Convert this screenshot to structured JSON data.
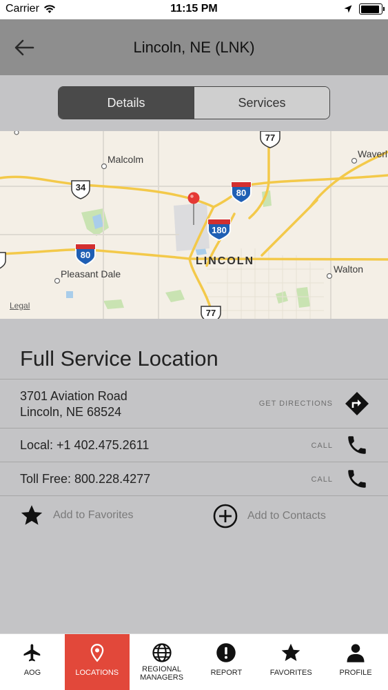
{
  "status_bar": {
    "carrier": "Carrier",
    "time": "11:15 PM",
    "battery_level": 0.9
  },
  "nav": {
    "title": "Lincoln, NE (LNK)",
    "back_icon": "arrow-left-icon"
  },
  "segments": {
    "items": [
      {
        "label": "Details",
        "active": true
      },
      {
        "label": "Services",
        "active": false
      }
    ]
  },
  "map": {
    "labels": {
      "malcolm": "Malcolm",
      "waverly": "Waverl",
      "pleasant_dale": "Pleasant Dale",
      "walton": "Walton",
      "city": "LINCOLN",
      "legal": "Legal"
    },
    "shields": {
      "us34": "34",
      "us77_top": "77",
      "us77_bottom": "77",
      "i80_west": "80",
      "i80_east": "80",
      "i180": "180"
    },
    "pin_color": "#e53935"
  },
  "location": {
    "title": "Full Service Location",
    "address_line1": "3701 Aviation Road",
    "address_line2": "Lincoln, NE  68524",
    "directions_label": "GET DIRECTIONS",
    "local_phone": "Local: +1 402.475.2611",
    "toll_free": "Toll Free: 800.228.4277",
    "call_label": "CALL",
    "add_favorites": "Add to Favorites",
    "add_contacts": "Add to Contacts"
  },
  "tab_bar": {
    "accent_color": "#e2483a",
    "tabs": [
      {
        "label": "AOG",
        "icon": "airplane-icon"
      },
      {
        "label": "LOCATIONS",
        "icon": "map-pin-icon",
        "active": true
      },
      {
        "label": "REGIONAL MANAGERS",
        "icon": "globe-icon"
      },
      {
        "label": "REPORT",
        "icon": "alert-icon"
      },
      {
        "label": "FAVORITES",
        "icon": "star-icon"
      },
      {
        "label": "PROFILE",
        "icon": "person-icon"
      }
    ]
  }
}
